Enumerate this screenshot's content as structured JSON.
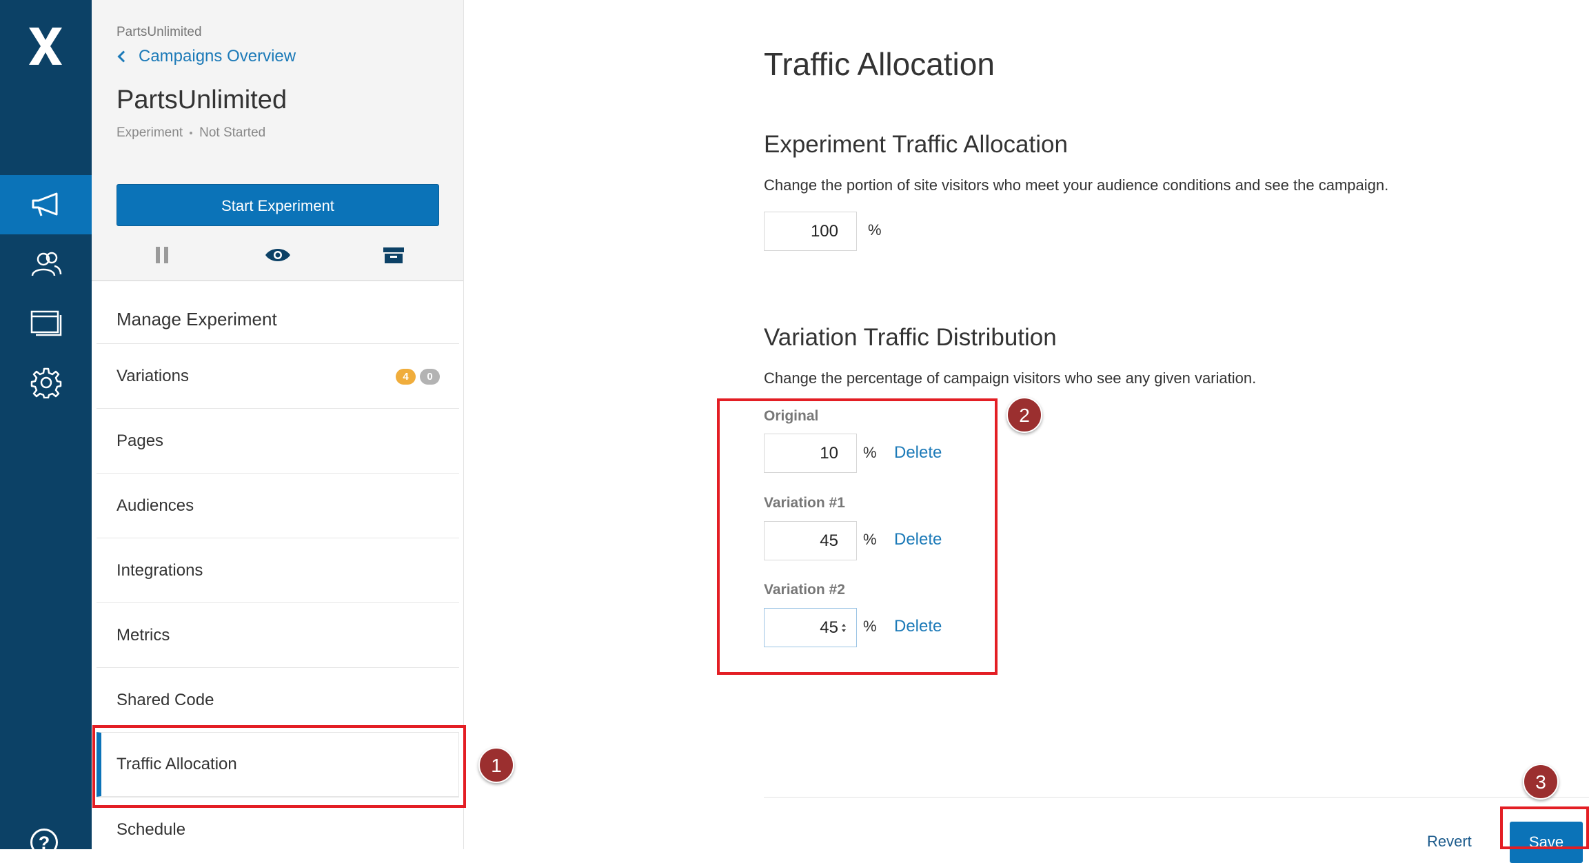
{
  "rail": {
    "items": [
      {
        "icon": "megaphone-icon",
        "active": true
      },
      {
        "icon": "audience-icon",
        "active": false
      },
      {
        "icon": "pages-icon",
        "active": false
      },
      {
        "icon": "gear-icon",
        "active": false
      }
    ],
    "help_label": "?"
  },
  "sidebar": {
    "org": "PartsUnlimited",
    "back_label": "Campaigns Overview",
    "campaign_title": "PartsUnlimited",
    "campaign_type": "Experiment",
    "campaign_status": "Not Started",
    "start_button": "Start Experiment",
    "manage_heading": "Manage Experiment",
    "nav": [
      {
        "label": "Variations",
        "badges": [
          "4",
          "0"
        ]
      },
      {
        "label": "Pages"
      },
      {
        "label": "Audiences"
      },
      {
        "label": "Integrations"
      },
      {
        "label": "Metrics"
      },
      {
        "label": "Shared Code"
      },
      {
        "label": "Traffic Allocation",
        "active": true
      },
      {
        "label": "Schedule"
      }
    ]
  },
  "main": {
    "title": "Traffic Allocation",
    "experiment": {
      "heading": "Experiment Traffic Allocation",
      "description": "Change the portion of site visitors who meet your audience conditions and see the campaign.",
      "value": "100",
      "unit": "%"
    },
    "distribution": {
      "heading": "Variation Traffic Distribution",
      "description": "Change the percentage of campaign visitors who see any given variation.",
      "variations": [
        {
          "label": "Original",
          "value": "10",
          "unit": "%",
          "delete_label": "Delete"
        },
        {
          "label": "Variation #1",
          "value": "45",
          "unit": "%",
          "delete_label": "Delete"
        },
        {
          "label": "Variation #2",
          "value": "45",
          "unit": "%",
          "delete_label": "Delete"
        }
      ]
    },
    "footer": {
      "revert_label": "Revert",
      "save_label": "Save"
    }
  },
  "annotations": [
    "1",
    "2",
    "3"
  ],
  "colors": {
    "rail": "#0c4166",
    "accent": "#0b73b8",
    "link": "#1c7ab8",
    "annotation_box": "#e31e24",
    "annotation_marker": "#9b2f2f",
    "badge_orange": "#f0ad3c",
    "badge_gray": "#b3b3b3"
  }
}
